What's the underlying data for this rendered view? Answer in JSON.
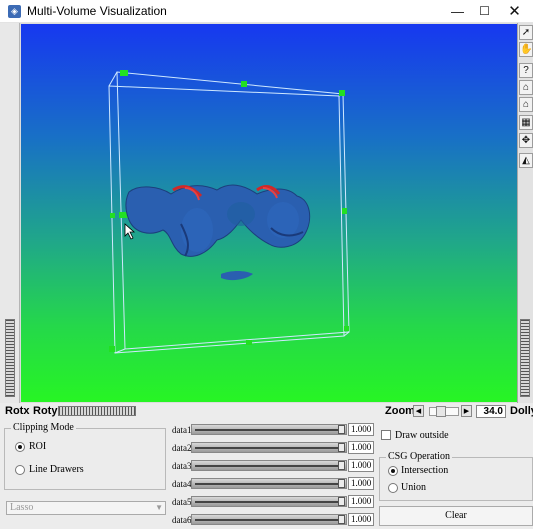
{
  "window": {
    "title": "Multi-Volume Visualization",
    "controls": {
      "minimize": "—",
      "maximize": "☐",
      "close": "✕"
    }
  },
  "viewer": {
    "toolbar_icons": [
      "arrow-pointer-icon",
      "hand-icon",
      "question-icon",
      "home-icon",
      "set-home-icon",
      "view-all-icon",
      "seek-icon",
      "perspective-icon"
    ],
    "bottom": {
      "rotx_label": "Rotx",
      "roty_label": "Roty",
      "zoom_label": "Zoom",
      "zoom_value": "34.0",
      "dolly_label": "Dolly",
      "left_arrow": "◀",
      "right_arrow": "▶"
    }
  },
  "clipping": {
    "title": "Clipping Mode",
    "options": [
      {
        "label": "ROI",
        "selected": true
      },
      {
        "label": "Line Drawers",
        "selected": false
      }
    ],
    "tool_select": {
      "value": "Lasso",
      "arrow": "▼"
    }
  },
  "data_sliders": [
    {
      "label": "data1",
      "value": "1.000"
    },
    {
      "label": "data2",
      "value": "1.000"
    },
    {
      "label": "data3",
      "value": "1.000"
    },
    {
      "label": "data4",
      "value": "1.000"
    },
    {
      "label": "data5",
      "value": "1.000"
    },
    {
      "label": "data6",
      "value": "1.000"
    }
  ],
  "draw_outside": {
    "label": "Draw outside",
    "checked": false
  },
  "csg": {
    "title": "CSG Operation",
    "options": [
      {
        "label": "Intersection",
        "selected": true
      },
      {
        "label": "Union",
        "selected": false
      }
    ],
    "clear_label": "Clear"
  },
  "colors": {
    "background_top": "#1738f0",
    "background_bottom": "#27f524",
    "volume": "#2a5fb0",
    "highlight": "#d02828",
    "bbox_handle": "#22e022"
  }
}
